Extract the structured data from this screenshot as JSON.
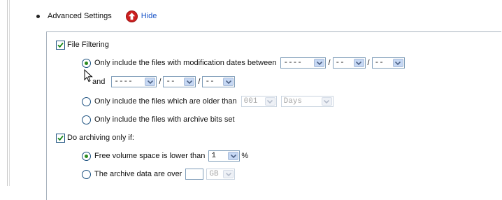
{
  "advanced": {
    "label": "Advanced Settings",
    "hide_label": "Hide"
  },
  "file_filtering": {
    "label": "File Filtering",
    "checked": true,
    "opt_between": {
      "label": "Only include the files with modification dates between",
      "and_label": "and",
      "date1": {
        "year": "----",
        "month": "--",
        "day": "--"
      },
      "date2": {
        "year": "----",
        "month": "--",
        "day": "--"
      },
      "separator": "/"
    },
    "opt_older": {
      "label": "Only include the files which are older than",
      "amount": "001",
      "unit": "Days"
    },
    "opt_archive_bits": {
      "label": "Only include the files with archive bits set"
    }
  },
  "archiving": {
    "label": "Do archiving only if:",
    "checked": true,
    "opt_free_space": {
      "label": "Free volume space is lower than",
      "value": "1",
      "unit": "%"
    },
    "opt_data_over": {
      "label": "The archive data are over",
      "value": "",
      "unit": "GB"
    }
  },
  "colors": {
    "link": "#1a55c8",
    "hide_icon": "#cc1f1f",
    "radio_dot": "#2a8a1e",
    "check": "#1b8a1b"
  },
  "icons": [
    "hide-up-arrow-icon",
    "checkmark-icon",
    "dropdown-arrow-icon",
    "mouse-pointer-icon"
  ]
}
